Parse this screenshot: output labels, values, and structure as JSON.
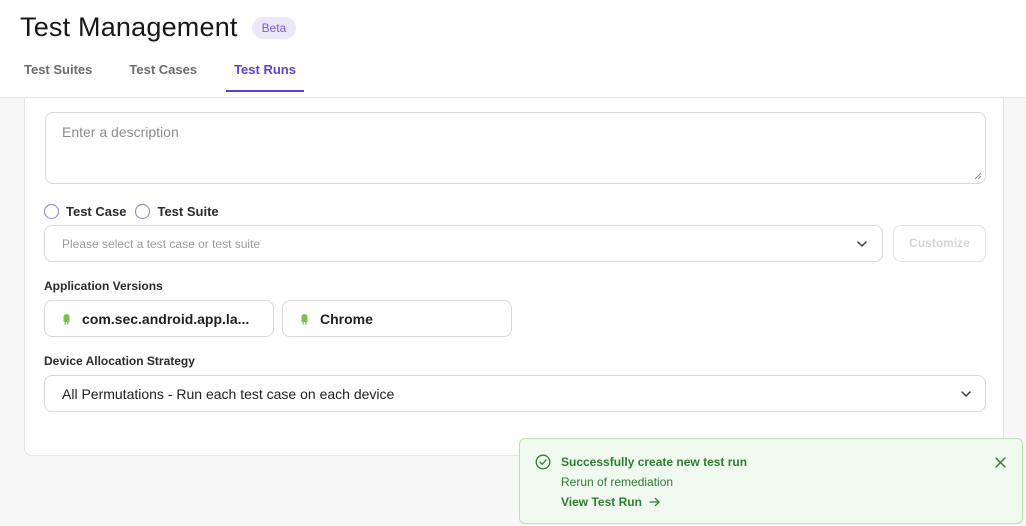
{
  "header": {
    "title": "Test Management",
    "badge": "Beta",
    "tabs": [
      {
        "label": "Test Suites",
        "active": false
      },
      {
        "label": "Test Cases",
        "active": false
      },
      {
        "label": "Test Runs",
        "active": true
      }
    ]
  },
  "form": {
    "description": {
      "placeholder": "Enter a description",
      "value": ""
    },
    "source_options": [
      {
        "label": "Test Case",
        "selected": false
      },
      {
        "label": "Test Suite",
        "selected": false
      }
    ],
    "test_select": {
      "placeholder": "Please select a test case or test suite",
      "icon": "chevron-down-icon"
    },
    "customize_label": "Customize",
    "app_versions": {
      "label": "Application Versions",
      "items": [
        {
          "text": "com.sec.android.app.la...",
          "icon": "android-icon"
        },
        {
          "text": "Chrome",
          "icon": "android-icon"
        }
      ]
    },
    "allocation": {
      "label": "Device Allocation Strategy",
      "value": "All Permutations - Run each test case on each device",
      "icon": "chevron-down-icon"
    }
  },
  "toast": {
    "title": "Successfully create new test run",
    "subtitle": "Rerun of remediation",
    "link": "View Test Run",
    "icons": [
      "check-circle-icon",
      "arrow-right-icon",
      "close-icon"
    ]
  },
  "colors": {
    "accent": "#5b3fd9",
    "badge_bg": "#ece7fb",
    "android_green": "#7cc04c",
    "success_text": "#2f7d32",
    "success_bg": "#f0f9ee",
    "success_border": "#b9e2b1"
  }
}
